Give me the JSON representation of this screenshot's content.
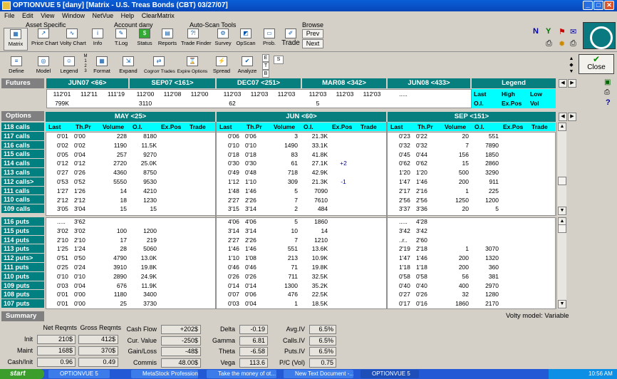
{
  "window": {
    "title": "OPTIONVUE 5   [dany]  [Matrix - U.S. Treas Bonds (CBT)  03/27/07]"
  },
  "menu": [
    "File",
    "Edit",
    "View",
    "Window",
    "NetVue",
    "Help",
    "ClearMatrix"
  ],
  "toolbar": {
    "groups": {
      "asset": "Asset Specific",
      "account": "Account dany",
      "autoscan": "Auto-Scan Tools",
      "browse": "Browse"
    },
    "buttons": [
      "Matrix",
      "Price Chart",
      "Volty Chart",
      "Info",
      "T.Log",
      "Status",
      "Reports",
      "Trade Finder",
      "Survey",
      "OpScan",
      "Prob.",
      "Trade"
    ],
    "prev": "Prev",
    "next": "Next",
    "row2": [
      "Define",
      "Model",
      "Legend",
      "Format",
      "Expand",
      "Cogrorr Trades",
      "Expire Options",
      "Spread",
      "Analyze"
    ],
    "mini": [
      "M",
      "1",
      "2",
      "3",
      "E",
      "T",
      "B",
      "S"
    ],
    "close": "Close"
  },
  "futures": {
    "label": "Futures",
    "months": [
      "JUN07 <66>",
      "SEP07 <161>",
      "DEC07 <251>",
      "MAR08 <342>",
      "JUN08 <433>"
    ],
    "legend": "Legend",
    "prices": [
      [
        "112'01",
        "112'11",
        "111'19"
      ],
      [
        "112'00",
        "112'08",
        "112'00"
      ],
      [
        "112'03",
        "112'03",
        "112'03"
      ],
      [
        "112'03",
        "112'03",
        "112'03"
      ],
      [
        ".....",
        "",
        ""
      ]
    ],
    "vols": [
      "799K",
      "3110",
      "62",
      "5",
      ""
    ],
    "legend_cells": [
      "Last",
      "High",
      "Low",
      "O.I.",
      "Ex.Pos",
      "Vol"
    ]
  },
  "options": {
    "label": "Options",
    "months": [
      "MAY <25>",
      "JUN <60>",
      "SEP <151>"
    ],
    "cols": [
      "Last",
      "Th.Pr",
      "Volume",
      "O.I.",
      "Ex.Pos",
      "Trade"
    ],
    "calls_labels": [
      "118 calls",
      "117 calls",
      "116 calls",
      "115 calls",
      "114 calls",
      "113 calls",
      "112 calls>",
      "111 calls",
      "110 calls",
      "109 calls"
    ],
    "puts_labels": [
      "116 puts",
      "115 puts",
      "114 puts",
      "113 puts",
      "112 puts>",
      "111 puts",
      "110 puts",
      "109 puts",
      "108 puts",
      "107 puts"
    ],
    "calls": [
      [
        [
          "0'01",
          "0'00",
          "228",
          "8180",
          ""
        ],
        [
          "0'06",
          "0'06",
          "3",
          "21.3K",
          ""
        ],
        [
          "0'23",
          "0'22",
          "20",
          "551",
          ""
        ]
      ],
      [
        [
          "0'02",
          "0'02",
          "1190",
          "11.5K",
          ""
        ],
        [
          "0'10",
          "0'10",
          "1490",
          "33.1K",
          ""
        ],
        [
          "0'32",
          "0'32",
          "7",
          "7890",
          ""
        ]
      ],
      [
        [
          "0'05",
          "0'04",
          "257",
          "9270",
          ""
        ],
        [
          "0'18",
          "0'18",
          "83",
          "41.8K",
          ""
        ],
        [
          "0'45",
          "0'44",
          "156",
          "1850",
          ""
        ]
      ],
      [
        [
          "0'12",
          "0'12",
          "2720",
          "25.0K",
          ""
        ],
        [
          "0'30",
          "0'30",
          "61",
          "27.1K",
          "+2"
        ],
        [
          "0'62",
          "0'62",
          "15",
          "2860",
          ""
        ]
      ],
      [
        [
          "0'27",
          "0'26",
          "4360",
          "8750",
          ""
        ],
        [
          "0'49",
          "0'48",
          "718",
          "42.9K",
          ""
        ],
        [
          "1'20",
          "1'20",
          "500",
          "3290",
          ""
        ]
      ],
      [
        [
          "0'53",
          "0'52",
          "5550",
          "9530",
          ""
        ],
        [
          "1'12",
          "1'10",
          "309",
          "21.3K",
          "-1"
        ],
        [
          "1'47",
          "1'46",
          "200",
          "911",
          ""
        ]
      ],
      [
        [
          "1'27",
          "1'26",
          "14",
          "4210",
          ""
        ],
        [
          "1'48",
          "1'46",
          "5",
          "7090",
          ""
        ],
        [
          "2'17",
          "2'16",
          "1",
          "225",
          ""
        ]
      ],
      [
        [
          "2'12",
          "2'12",
          "18",
          "1230",
          ""
        ],
        [
          "2'27",
          "2'26",
          "7",
          "7610",
          ""
        ],
        [
          "2'56",
          "2'56",
          "1250",
          "1200",
          ""
        ]
      ],
      [
        [
          "3'05",
          "3'04",
          "15",
          "15",
          ""
        ],
        [
          "3'15",
          "3'14",
          "2",
          "484",
          ""
        ],
        [
          "3'37",
          "3'36",
          "20",
          "5",
          ""
        ]
      ]
    ],
    "puts": [
      [
        [
          ".....",
          "3'62",
          "",
          "",
          ""
        ],
        [
          "4'06",
          "4'06",
          "5",
          "1860",
          ""
        ],
        [
          ".....",
          "4'28",
          "",
          "",
          ""
        ]
      ],
      [
        [
          "3'02",
          "3'02",
          "100",
          "1200",
          ""
        ],
        [
          "3'14",
          "3'14",
          "10",
          "14",
          ""
        ],
        [
          "3'42",
          "3'42",
          "",
          "",
          ""
        ]
      ],
      [
        [
          "2'10",
          "2'10",
          "17",
          "219",
          ""
        ],
        [
          "2'27",
          "2'26",
          "7",
          "1210",
          ""
        ],
        [
          "..r..",
          "2'60",
          "",
          "",
          ""
        ]
      ],
      [
        [
          "1'25",
          "1'24",
          "28",
          "5060",
          ""
        ],
        [
          "1'46",
          "1'46",
          "551",
          "13.6K",
          ""
        ],
        [
          "2'19",
          "2'18",
          "1",
          "3070",
          ""
        ]
      ],
      [
        [
          "0'51",
          "0'50",
          "4790",
          "13.0K",
          ""
        ],
        [
          "1'10",
          "1'08",
          "213",
          "10.9K",
          ""
        ],
        [
          "1'47",
          "1'46",
          "200",
          "1320",
          ""
        ]
      ],
      [
        [
          "0'25",
          "0'24",
          "3910",
          "19.8K",
          ""
        ],
        [
          "0'46",
          "0'46",
          "71",
          "19.8K",
          ""
        ],
        [
          "1'18",
          "1'18",
          "200",
          "360",
          ""
        ]
      ],
      [
        [
          "0'10",
          "0'10",
          "2890",
          "24.9K",
          ""
        ],
        [
          "0'26",
          "0'26",
          "711",
          "32.5K",
          ""
        ],
        [
          "0'58",
          "0'58",
          "56",
          "381",
          ""
        ]
      ],
      [
        [
          "0'03",
          "0'04",
          "676",
          "11.9K",
          ""
        ],
        [
          "0'14",
          "0'14",
          "1300",
          "35.2K",
          ""
        ],
        [
          "0'40",
          "0'40",
          "400",
          "2970",
          ""
        ]
      ],
      [
        [
          "0'01",
          "0'00",
          "1180",
          "3400",
          ""
        ],
        [
          "0'07",
          "0'06",
          "476",
          "22.5K",
          ""
        ],
        [
          "0'27",
          "0'26",
          "32",
          "1280",
          ""
        ]
      ],
      [
        [
          "0'01",
          "0'00",
          "25",
          "3730",
          ""
        ],
        [
          "0'03",
          "0'04",
          "1",
          "18.5K",
          ""
        ],
        [
          "0'17",
          "0'16",
          "1860",
          "2170",
          ""
        ]
      ]
    ]
  },
  "summary": {
    "label": "Summary",
    "volty_model": "Volty model: Variable",
    "hdr_net": "Net Reqmts",
    "hdr_gross": "Gross Reqmts",
    "rows": [
      [
        "Init",
        "210$",
        "412$"
      ],
      [
        "Maint",
        "168$",
        "370$"
      ],
      [
        "Cash/Init",
        "0.96",
        "0.49"
      ]
    ],
    "mid": [
      [
        "Cash Flow",
        "+202$"
      ],
      [
        "Cur. Value",
        "-250$"
      ],
      [
        "Gain/Loss",
        "-48$"
      ],
      [
        "Commis",
        "48.00$"
      ]
    ],
    "greeks": [
      [
        "Delta",
        "-0.19"
      ],
      [
        "Gamma",
        "6.81"
      ],
      [
        "Theta",
        "-6.58"
      ],
      [
        "Vega",
        "113.6"
      ]
    ],
    "ivs": [
      [
        "Avg.IV",
        "6.5%"
      ],
      [
        "Calls.IV",
        "6.5%"
      ],
      [
        "Puts.IV",
        "6.5%"
      ],
      [
        "P/C (Vol)",
        "0.75"
      ]
    ]
  },
  "taskbar": {
    "start": "start",
    "tasks": [
      "OPTIONVUE 5",
      "MetaStock Profession...",
      "Take the money of ot...",
      "New Text Document -...",
      "OPTIONVUE 5"
    ],
    "clock": "10:56 AM"
  }
}
